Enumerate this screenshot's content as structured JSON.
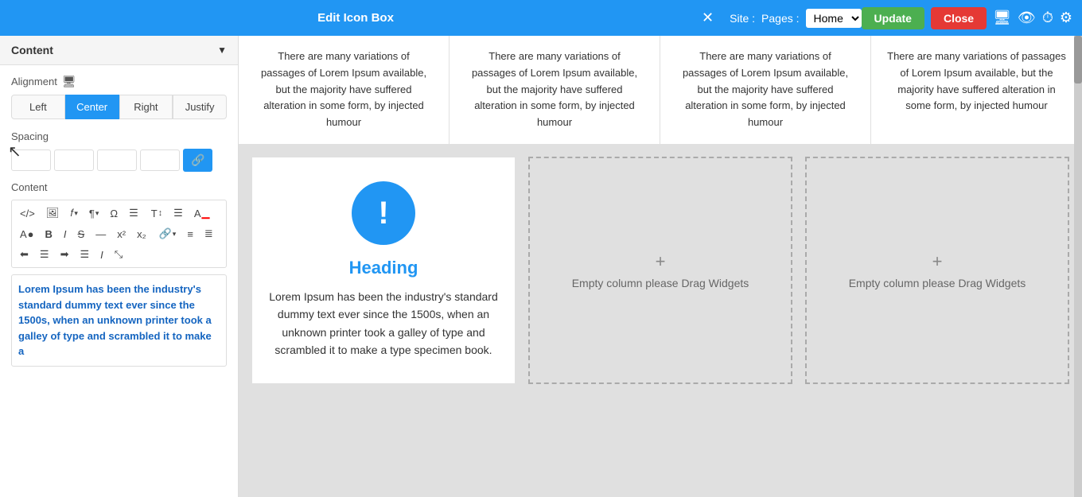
{
  "topbar": {
    "panel_title": "Edit Icon Box",
    "close_label": "✕",
    "site_label": "Site :",
    "pages_label": "Pages :",
    "page_current": "Home",
    "update_label": "Update",
    "close_btn_label": "Close"
  },
  "left_panel": {
    "content_section_label": "Content",
    "alignment_label": "Alignment",
    "align_buttons": [
      "Left",
      "Center",
      "Right",
      "Justify"
    ],
    "active_align": "Center",
    "spacing_label": "Spacing",
    "content_label": "Content",
    "editor_text": "Lorem Ipsum has been the industry's standard dummy text ever since the 1500s, when an unknown printer took a galley of type and scrambled it to make a"
  },
  "lorem_columns": [
    "There are many variations of passages of Lorem Ipsum available, but the majority have suffered alteration in some form, by injected humour",
    "There are many variations of passages of Lorem Ipsum available, but the majority have suffered alteration in some form, by injected humour",
    "There are many variations of passages of Lorem Ipsum available, but the majority have suffered alteration in some form, by injected humour",
    "There are many variations of passages of Lorem Ipsum available, but the majority have suffered alteration in some form, by injected humour"
  ],
  "widget": {
    "heading": "Heading",
    "text": "Lorem Ipsum has been the industry's standard dummy text ever since the 1500s, when an unknown printer took a galley of type and scrambled it to make a type specimen book."
  },
  "empty_columns": [
    {
      "label": "Empty column please Drag Widgets",
      "plus": "+"
    },
    {
      "label": "Empty column please Drag Widgets",
      "plus": "+"
    }
  ],
  "toolbar_buttons": [
    {
      "label": "</>",
      "name": "source-btn"
    },
    {
      "label": "🖼",
      "name": "image-btn"
    },
    {
      "label": "𝒻▾",
      "name": "font-btn"
    },
    {
      "label": "¶▾",
      "name": "paragraph-btn"
    },
    {
      "label": "✦",
      "name": "special-btn"
    },
    {
      "label": "☰",
      "name": "format-btn"
    },
    {
      "label": "T↕",
      "name": "text-size-btn"
    },
    {
      "label": "☰≡",
      "name": "list-btn"
    },
    {
      "label": "A̲",
      "name": "underline-color-btn"
    },
    {
      "label": "A●",
      "name": "font-color-btn"
    },
    {
      "label": "B",
      "name": "bold-btn"
    },
    {
      "label": "I",
      "name": "italic-btn"
    },
    {
      "label": "S̶",
      "name": "strike-btn"
    },
    {
      "label": "—",
      "name": "hr-btn"
    },
    {
      "label": "x²",
      "name": "superscript-btn"
    },
    {
      "label": "x₂",
      "name": "subscript-btn"
    },
    {
      "label": "🔗▾",
      "name": "link-btn"
    },
    {
      "label": "≡",
      "name": "ul-btn"
    },
    {
      "label": "≣",
      "name": "ol-btn"
    },
    {
      "label": "⟵",
      "name": "align-left-btn"
    },
    {
      "label": "⟺",
      "name": "align-center-btn"
    },
    {
      "label": "⟶",
      "name": "align-right-btn"
    },
    {
      "label": "⟺⟺",
      "name": "align-justify-btn"
    },
    {
      "label": "I",
      "name": "italic2-btn"
    },
    {
      "label": "⤡",
      "name": "fullscreen-btn"
    }
  ]
}
